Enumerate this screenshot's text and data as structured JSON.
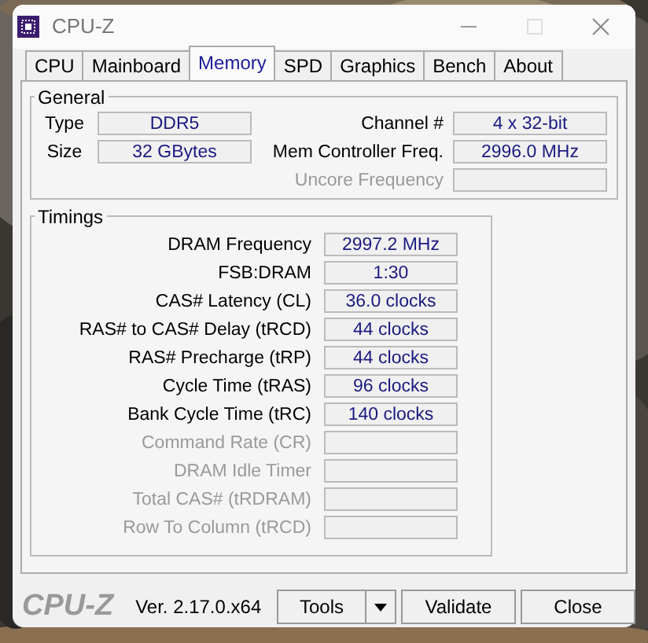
{
  "window": {
    "title": "CPU-Z"
  },
  "tabs": [
    {
      "label": "CPU",
      "selected": false
    },
    {
      "label": "Mainboard",
      "selected": false
    },
    {
      "label": "Memory",
      "selected": true
    },
    {
      "label": "SPD",
      "selected": false
    },
    {
      "label": "Graphics",
      "selected": false
    },
    {
      "label": "Bench",
      "selected": false
    },
    {
      "label": "About",
      "selected": false
    }
  ],
  "general": {
    "title": "General",
    "left": [
      {
        "label": "Type",
        "value": "DDR5"
      },
      {
        "label": "Size",
        "value": "32 GBytes"
      }
    ],
    "right": [
      {
        "label": "Channel #",
        "value": "4 x 32-bit",
        "disabled": false
      },
      {
        "label": "Mem Controller Freq.",
        "value": "2996.0 MHz",
        "disabled": false
      },
      {
        "label": "Uncore Frequency",
        "disabled": true
      }
    ]
  },
  "timings": {
    "title": "Timings",
    "rows": [
      {
        "label": "DRAM Frequency",
        "value": "2997.2 MHz",
        "disabled": false
      },
      {
        "label": "FSB:DRAM",
        "value": "1:30",
        "disabled": false
      },
      {
        "label": "CAS# Latency (CL)",
        "value": "36.0 clocks",
        "disabled": false
      },
      {
        "label": "RAS# to CAS# Delay (tRCD)",
        "value": "44 clocks",
        "disabled": false
      },
      {
        "label": "RAS# Precharge (tRP)",
        "value": "44 clocks",
        "disabled": false
      },
      {
        "label": "Cycle Time (tRAS)",
        "value": "96 clocks",
        "disabled": false
      },
      {
        "label": "Bank Cycle Time (tRC)",
        "value": "140 clocks",
        "disabled": false
      },
      {
        "label": "Command Rate (CR)",
        "disabled": true
      },
      {
        "label": "DRAM Idle Timer",
        "disabled": true
      },
      {
        "label": "Total CAS# (tRDRAM)",
        "disabled": true
      },
      {
        "label": "Row To Column (tRCD)",
        "disabled": true
      }
    ]
  },
  "footer": {
    "logo": "CPU-Z",
    "version": "Ver. 2.17.0.x64",
    "tools": "Tools",
    "validate": "Validate",
    "close": "Close"
  }
}
